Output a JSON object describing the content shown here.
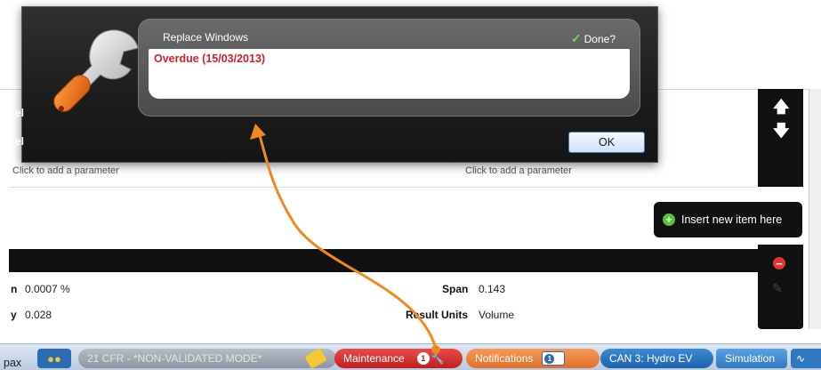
{
  "dialog": {
    "title": "Replace Windows",
    "done_label": "Done?",
    "message": "Overdue (15/03/2013)",
    "ok_label": "OK",
    "left_labels": [
      "el",
      "el"
    ]
  },
  "parameters": {
    "left_placeholder": "Click to add a parameter",
    "right_placeholder": "Click to add a parameter"
  },
  "insert_button": {
    "label": "Insert new item here"
  },
  "fields": {
    "row1_left_label": "n",
    "row1_left_value": "0.0007 %",
    "row1_right_label": "Span",
    "row1_right_value": "0.143",
    "row2_left_label": "y",
    "row2_left_value": "0.028",
    "row2_right_label": "Result Units",
    "row2_right_value": "Volume"
  },
  "taskbar": {
    "pax": "pax",
    "cfr": "21 CFR - *NON-VALIDATED MODE*",
    "maintenance": "Maintenance",
    "maintenance_badge": "1",
    "notifications": "Notifications",
    "notifications_badge": "1",
    "can": "CAN 3: Hydro EV",
    "simulation": "Simulation"
  },
  "colors": {
    "maintenance": "#d32f2f",
    "notifications": "#ec7f3a",
    "overdue_text": "#d31f27",
    "callout_arrow": "#f08a1c"
  }
}
